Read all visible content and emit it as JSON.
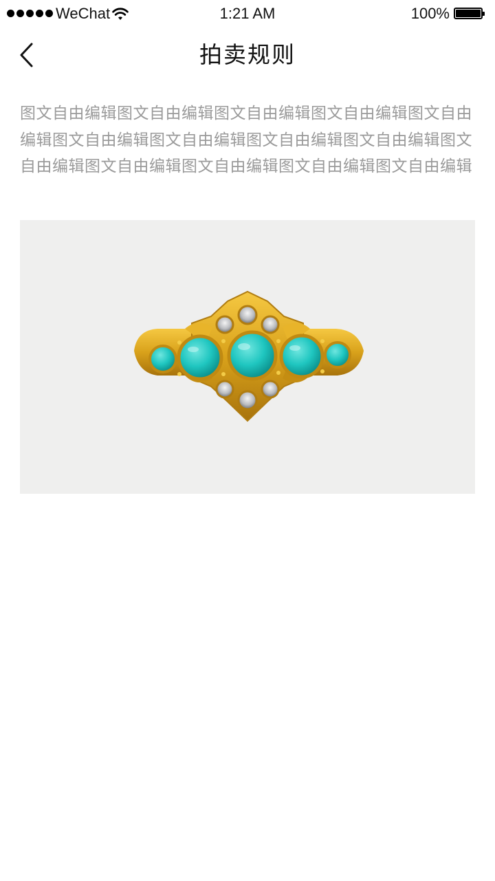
{
  "status_bar": {
    "carrier": "WeChat",
    "time": "1:21 AM",
    "battery_percent": "100%"
  },
  "nav": {
    "title": "拍卖规则",
    "back_icon": "chevron-left-icon"
  },
  "content": {
    "description": "图文自由编辑图文自由编辑图文自由编辑图文自由编辑图文自由编辑图文自由编辑图文自由编辑图文自由编辑图文自由编辑图文自由编辑图文自由编辑图文自由编辑图文自由编辑图文自由编辑",
    "image_subject": "turquoise-gold-ring-image",
    "image_background": "#efefee",
    "stone_color": "#1fc6c0",
    "metal_color": "#d9a21b"
  }
}
